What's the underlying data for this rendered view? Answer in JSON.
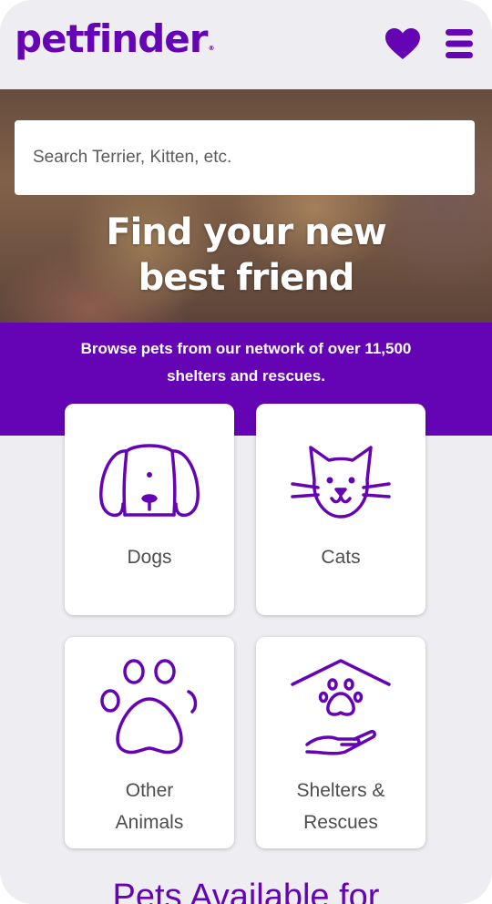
{
  "header": {
    "logo_text": "petfinder",
    "logo_registered": "®",
    "favorites_icon": "heart-icon",
    "menu_icon": "hamburger-menu-icon"
  },
  "hero": {
    "search_placeholder": "Search Terrier, Kitten, etc.",
    "title_line1": "Find your new",
    "title_line2": "best friend"
  },
  "band": {
    "line1": "Browse pets from our network of over 11,500",
    "line2": "shelters and rescues."
  },
  "categories": [
    {
      "icon": "dog-icon",
      "label_line1": "Dogs",
      "label_line2": ""
    },
    {
      "icon": "cat-icon",
      "label_line1": "Cats",
      "label_line2": ""
    },
    {
      "icon": "paw-icon",
      "label_line1": "Other",
      "label_line2": "Animals"
    },
    {
      "icon": "shelter-icon",
      "label_line1": "Shelters &",
      "label_line2": "Rescues"
    }
  ],
  "section_heading": "Pets Available for",
  "colors": {
    "brand_purple": "#6504b5",
    "page_bg": "#eeedf1",
    "label_gray": "#4d4d4d"
  }
}
